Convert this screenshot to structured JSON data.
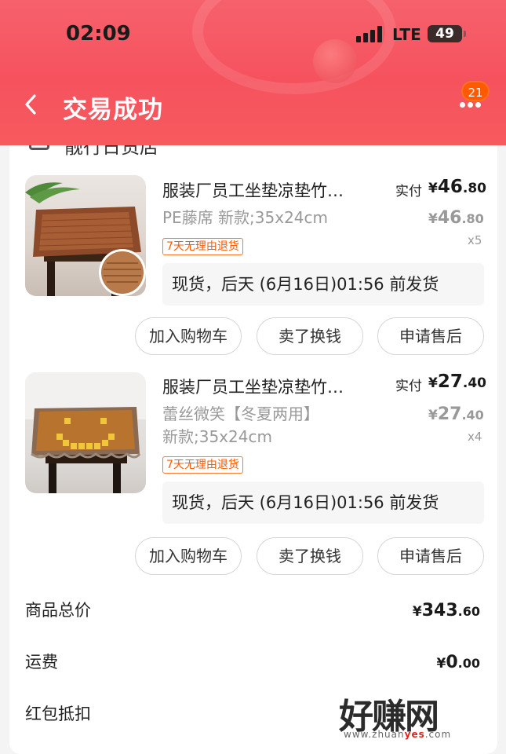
{
  "status_bar": {
    "time": "02:09",
    "network": "LTE",
    "battery": "49"
  },
  "nav": {
    "title": "交易成功",
    "badge_count": "21"
  },
  "shop": {
    "name": "靓行日货店"
  },
  "items": [
    {
      "title": "服装厂员工坐垫凉垫竹…",
      "spec": "PE藤席 新款;35x24cm",
      "tag": "7天无理由退货",
      "paid_label": "实付",
      "paid": {
        "yen": "¥",
        "int": "46",
        "dec": ".80"
      },
      "original": {
        "yen": "¥",
        "int": "46",
        "dec": ".80"
      },
      "quantity": "x5",
      "shipping": "现货，后天 (6月16日)01:56 前发货",
      "buttons": [
        "加入购物车",
        "卖了换钱",
        "申请售后"
      ]
    },
    {
      "title": "服装厂员工坐垫凉垫竹…",
      "spec": "蕾丝微笑【冬夏两用】\n新款;35x24cm",
      "tag": "7天无理由退货",
      "paid_label": "实付",
      "paid": {
        "yen": "¥",
        "int": "27",
        "dec": ".40"
      },
      "original": {
        "yen": "¥",
        "int": "27",
        "dec": ".40"
      },
      "quantity": "x4",
      "shipping": "现货，后天 (6月16日)01:56 前发货",
      "buttons": [
        "加入购物车",
        "卖了换钱",
        "申请售后"
      ]
    }
  ],
  "summary": {
    "goods_total_label": "商品总价",
    "goods_total": {
      "yen": "¥",
      "int": "343",
      "dec": ".60"
    },
    "shipping_label": "运费",
    "shipping": {
      "yen": "¥",
      "int": "0",
      "dec": ".00"
    },
    "redpacket_label": "红包抵扣"
  },
  "watermark": {
    "text": "好赚网",
    "url_prefix": "www.zhuan",
    "url_mid": "yes",
    "url_suffix": ".com"
  },
  "colors": {
    "header_red": "#f5525e",
    "tag_orange": "#ff5a00",
    "badge_orange": "#ff5a00"
  },
  "icons": {
    "back": "chevron-left-icon",
    "more": "more-dots-icon",
    "check": "checkbox-icon"
  }
}
